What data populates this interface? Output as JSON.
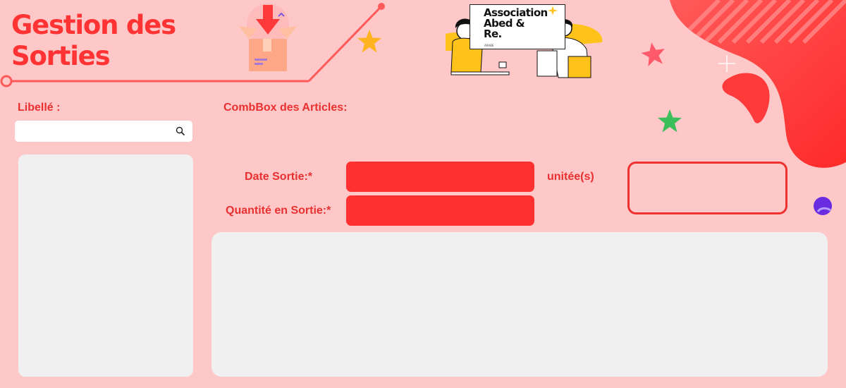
{
  "header": {
    "title_line1": "Gestion des",
    "title_line2": "Sorties"
  },
  "logo": {
    "line1": "Association",
    "line2": "Abed &",
    "line3": "Re.",
    "sub": "ARABE"
  },
  "left": {
    "libelle_label": "Libellé :",
    "search_value": "",
    "search_placeholder": ""
  },
  "form": {
    "combobox_label": "CombBox des Articles:",
    "date_label": "Date Sortie:*",
    "date_value": "",
    "quantity_label": "Quantité en Sortie:*",
    "quantity_value": "",
    "unit_label": "unitée(s)",
    "unit_value": ""
  },
  "colors": {
    "background": "#ffc8c8",
    "accent_red": "#ff3030",
    "label_red": "#e83030",
    "panel_gray": "#f0f0f0",
    "star_green": "#3cbf5a",
    "dot_purple": "#6a2ce0"
  },
  "icons": {
    "search": "search-icon",
    "box_download": "download-box-icon",
    "stars": "star-icon"
  }
}
